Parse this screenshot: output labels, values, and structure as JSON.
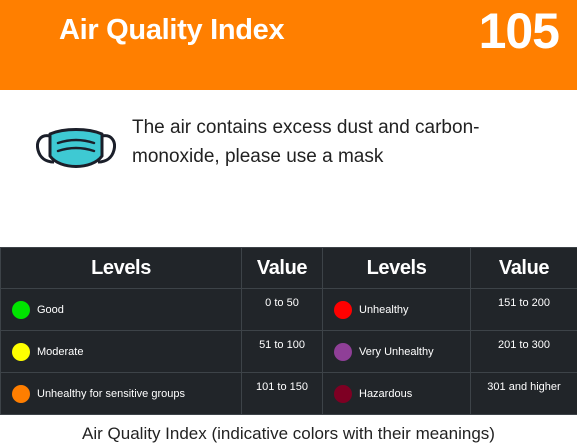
{
  "header": {
    "title": "Air Quality Index",
    "aqi_value": "105",
    "color": "#ff7f00"
  },
  "advice": {
    "icon": "face-mask-icon",
    "message": "The air contains excess dust and carbon-monoxide, please use a mask"
  },
  "levels_table": {
    "headers": [
      "Levels",
      "Value",
      "Levels",
      "Value"
    ],
    "left": [
      {
        "label": "Good",
        "value": "0 to 50",
        "color": "#00e400"
      },
      {
        "label": "Moderate",
        "value": "51 to 100",
        "color": "#ffff00"
      },
      {
        "label": "Unhealthy for sensitive groups",
        "value": "101 to 150",
        "color": "#ff7e00"
      }
    ],
    "right": [
      {
        "label": "Unhealthy",
        "value": "151 to 200",
        "color": "#ff0000"
      },
      {
        "label": "Very Unhealthy",
        "value": "201 to 300",
        "color": "#8f3f97"
      },
      {
        "label": "Hazardous",
        "value": "301 and higher",
        "color": "#7e0023"
      }
    ]
  },
  "caption": "Air Quality Index (indicative colors with their meanings)"
}
